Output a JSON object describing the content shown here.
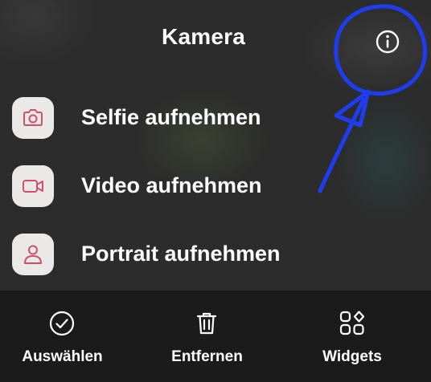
{
  "header": {
    "title": "Kamera",
    "info_icon": "info-circle-icon"
  },
  "menu": {
    "items": [
      {
        "label": "Selfie aufnehmen",
        "icon": "camera-icon"
      },
      {
        "label": "Video aufnehmen",
        "icon": "video-camera-icon"
      },
      {
        "label": "Portrait aufnehmen",
        "icon": "person-icon"
      }
    ]
  },
  "bottom_bar": {
    "items": [
      {
        "label": "Auswählen",
        "icon": "check-circle-icon"
      },
      {
        "label": "Entfernen",
        "icon": "trash-icon"
      },
      {
        "label": "Widgets",
        "icon": "widgets-icon"
      }
    ]
  },
  "colors": {
    "accent_icon": "#d0506e",
    "annotation": "#1f3df0",
    "tile_background": "#ebe8e8",
    "bottom_bar_background": "#1b1b1b"
  }
}
